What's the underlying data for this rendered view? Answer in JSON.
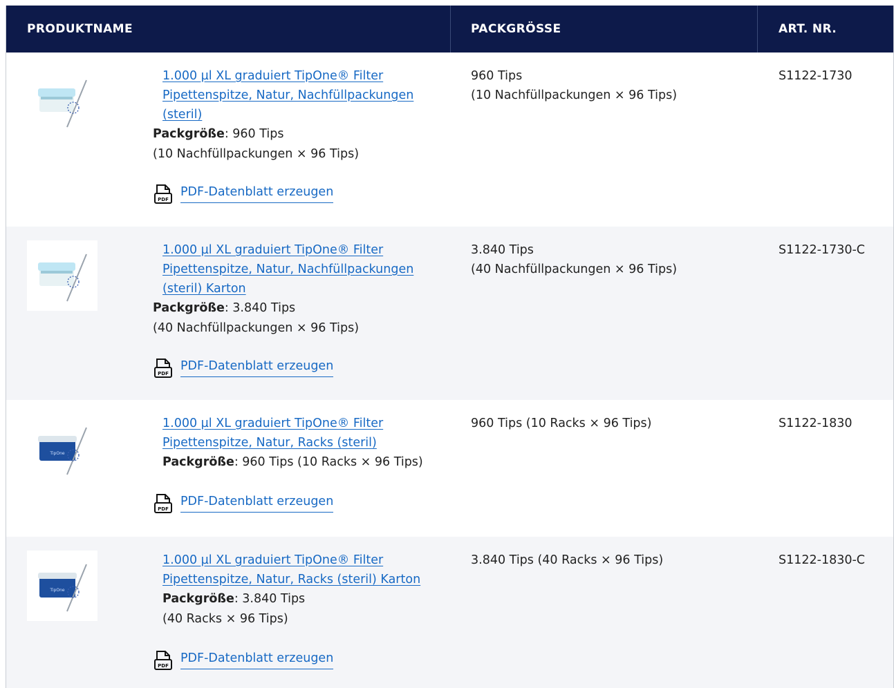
{
  "header": {
    "col_name": "PRODUKTNAME",
    "col_pack": "PACKGRÖSSE",
    "col_art": "ART. NR."
  },
  "rows": [
    {
      "name_lines": [
        "1.000 µl XL graduiert TipOne® Filter",
        "Pipettenspitze, Natur, Nachfüllpackungen",
        "(steril)"
      ],
      "pack_label": "Packgröße",
      "pack_detail_lines": [
        ": 960 Tips",
        "(10 Nachfüllpackungen × 96 Tips)"
      ],
      "pack_col_lines": [
        "960 Tips",
        "(10 Nachfüllpackungen × 96 Tips)"
      ],
      "art_nr": "S1122-1730",
      "pdf_label": "PDF-Datenblatt erzeugen",
      "thumb_icon": "refill-box-product-icon",
      "pdf_icon_text": "PDF"
    },
    {
      "name_lines": [
        "1.000 µl XL graduiert TipOne® Filter",
        "Pipettenspitze, Natur, Nachfüllpackungen",
        "(steril) Karton"
      ],
      "pack_label": "Packgröße",
      "pack_detail_lines": [
        ": 3.840 Tips",
        "(40 Nachfüllpackungen × 96 Tips)"
      ],
      "pack_col_lines": [
        "3.840 Tips",
        "(40 Nachfüllpackungen × 96 Tips)"
      ],
      "art_nr": "S1122-1730-C",
      "pdf_label": "PDF-Datenblatt erzeugen",
      "thumb_icon": "refill-box-product-icon",
      "pdf_icon_text": "PDF"
    },
    {
      "name_lines": [
        "1.000 µl XL graduiert TipOne® Filter",
        "Pipettenspitze, Natur, Racks (steril)"
      ],
      "pack_label": "Packgröße",
      "pack_detail_lines": [
        ": 960 Tips (10 Racks × 96 Tips)"
      ],
      "pack_col_lines": [
        "960 Tips (10 Racks × 96 Tips)"
      ],
      "art_nr": "S1122-1830",
      "pdf_label": "PDF-Datenblatt erzeugen",
      "thumb_icon": "rack-box-product-icon",
      "thumb_brand": "TipOne",
      "pdf_icon_text": "PDF"
    },
    {
      "name_lines": [
        "1.000 µl XL graduiert TipOne® Filter",
        "Pipettenspitze, Natur, Racks (steril) Karton"
      ],
      "pack_label": "Packgröße",
      "pack_detail_lines": [
        ": 3.840 Tips",
        "(40 Racks × 96 Tips)"
      ],
      "pack_col_lines": [
        "3.840 Tips (40 Racks × 96 Tips)"
      ],
      "art_nr": "S1122-1830-C",
      "pdf_label": "PDF-Datenblatt erzeugen",
      "thumb_icon": "rack-box-product-icon",
      "thumb_brand": "TipOne",
      "pdf_icon_text": "PDF"
    }
  ],
  "colors": {
    "header_bg": "#0d1a4a",
    "link": "#1769c4",
    "alt_row": "#f4f5f8",
    "refill_lid": "#bfe6f4",
    "rack_box": "#1e4f9e"
  }
}
